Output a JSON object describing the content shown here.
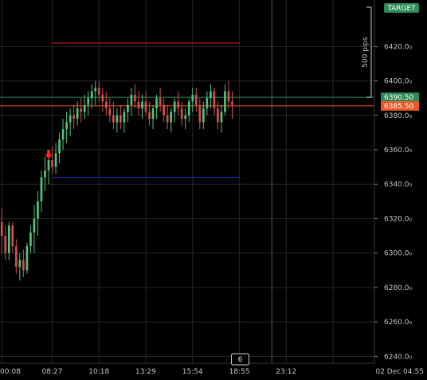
{
  "chart_data": {
    "type": "candlestick",
    "y_axis": {
      "range": [
        6236,
        6447
      ],
      "tick_labels": [
        "6420.0₀",
        "6400.0₀",
        "6380.0₀",
        "6360.0₀",
        "6340.0₀",
        "6320.0₀",
        "6300.0₀",
        "6280.0₀",
        "6260.0₀",
        "6240.0₀"
      ],
      "tick_values": [
        6420,
        6400,
        6380,
        6360,
        6340,
        6320,
        6300,
        6280,
        6260,
        6240
      ]
    },
    "x_axis": {
      "tick_labels": [
        "00:08",
        "08:27",
        "10:18",
        "13:29",
        "15:54",
        "18:55",
        "23:12",
        "02 Dec 04:55"
      ],
      "tick_index": [
        0,
        14,
        27,
        40,
        53,
        66,
        79,
        92
      ],
      "index_range": [
        -0.5,
        103.5
      ]
    },
    "grid": true,
    "candles": [
      [
        6318,
        6326,
        6300,
        6310
      ],
      [
        6310,
        6316,
        6296,
        6300
      ],
      [
        6300,
        6318,
        6296,
        6316
      ],
      [
        6316,
        6318,
        6300,
        6304
      ],
      [
        6304,
        6308,
        6288,
        6292
      ],
      [
        6292,
        6300,
        6284,
        6296
      ],
      [
        6296,
        6302,
        6286,
        6290
      ],
      [
        6290,
        6306,
        6288,
        6304
      ],
      [
        6304,
        6316,
        6300,
        6312
      ],
      [
        6312,
        6328,
        6300,
        6320
      ],
      [
        6320,
        6336,
        6310,
        6330
      ],
      [
        6330,
        6348,
        6324,
        6344
      ],
      [
        6344,
        6356,
        6336,
        6348
      ],
      [
        6348,
        6360,
        6340,
        6354
      ],
      [
        6354,
        6362,
        6346,
        6350
      ],
      [
        6350,
        6364,
        6346,
        6358
      ],
      [
        6358,
        6370,
        6352,
        6366
      ],
      [
        6366,
        6378,
        6360,
        6372
      ],
      [
        6372,
        6382,
        6364,
        6376
      ],
      [
        6376,
        6384,
        6368,
        6380
      ],
      [
        6380,
        6386,
        6372,
        6378
      ],
      [
        6378,
        6388,
        6374,
        6384
      ],
      [
        6384,
        6390,
        6376,
        6382
      ],
      [
        6382,
        6392,
        6378,
        6386
      ],
      [
        6386,
        6394,
        6380,
        6390
      ],
      [
        6390,
        6398,
        6384,
        6394
      ],
      [
        6394,
        6400,
        6386,
        6396
      ],
      [
        6396,
        6400,
        6388,
        6392
      ],
      [
        6392,
        6396,
        6382,
        6388
      ],
      [
        6388,
        6394,
        6380,
        6384
      ],
      [
        6384,
        6390,
        6376,
        6380
      ],
      [
        6380,
        6388,
        6372,
        6376
      ],
      [
        6376,
        6384,
        6370,
        6380
      ],
      [
        6380,
        6386,
        6372,
        6376
      ],
      [
        6376,
        6384,
        6370,
        6382
      ],
      [
        6382,
        6390,
        6376,
        6386
      ],
      [
        6386,
        6396,
        6380,
        6392
      ],
      [
        6392,
        6398,
        6384,
        6388
      ],
      [
        6388,
        6394,
        6380,
        6384
      ],
      [
        6384,
        6392,
        6378,
        6388
      ],
      [
        6388,
        6394,
        6380,
        6382
      ],
      [
        6382,
        6388,
        6374,
        6378
      ],
      [
        6378,
        6386,
        6372,
        6384
      ],
      [
        6384,
        6392,
        6378,
        6390
      ],
      [
        6390,
        6396,
        6382,
        6386
      ],
      [
        6386,
        6390,
        6376,
        6380
      ],
      [
        6380,
        6386,
        6372,
        6376
      ],
      [
        6376,
        6384,
        6370,
        6382
      ],
      [
        6382,
        6390,
        6376,
        6388
      ],
      [
        6388,
        6394,
        6380,
        6384
      ],
      [
        6384,
        6388,
        6374,
        6378
      ],
      [
        6378,
        6384,
        6372,
        6380
      ],
      [
        6380,
        6390,
        6376,
        6388
      ],
      [
        6388,
        6396,
        6382,
        6392
      ],
      [
        6392,
        6396,
        6382,
        6386
      ],
      [
        6386,
        6390,
        6372,
        6376
      ],
      [
        6376,
        6388,
        6372,
        6384
      ],
      [
        6384,
        6394,
        6380,
        6390
      ],
      [
        6390,
        6398,
        6384,
        6394
      ],
      [
        6394,
        6396,
        6380,
        6384
      ],
      [
        6384,
        6388,
        6372,
        6376
      ],
      [
        6376,
        6386,
        6370,
        6382
      ],
      [
        6382,
        6398,
        6380,
        6394
      ],
      [
        6394,
        6400,
        6384,
        6388
      ],
      [
        6388,
        6394,
        6378,
        6386
      ]
    ],
    "levels": [
      {
        "name": "TARGET",
        "value": 6390.5,
        "label": "6390.50",
        "color": "#2e8b57"
      },
      {
        "name": "current",
        "value": 6385.5,
        "label": "6385.50",
        "color": "#e85a2a"
      }
    ],
    "upper_red_line": {
      "value": 6422,
      "index_range": [
        14,
        66
      ],
      "color": "#d02020"
    },
    "blue_line": {
      "value": 6344,
      "index_range": [
        14,
        66
      ],
      "color": "#2030d0"
    },
    "entry_arrow": {
      "index": 13,
      "value": 6356,
      "color": "#ff2020"
    },
    "vertical_line_index": 75,
    "target_label": "TARGET",
    "pips_label": "500 pips",
    "bottom_counter": "6",
    "colors": {
      "up": "#55c080",
      "down": "#d05050",
      "grid": "#262626",
      "axis": "#3a3a3a"
    }
  }
}
